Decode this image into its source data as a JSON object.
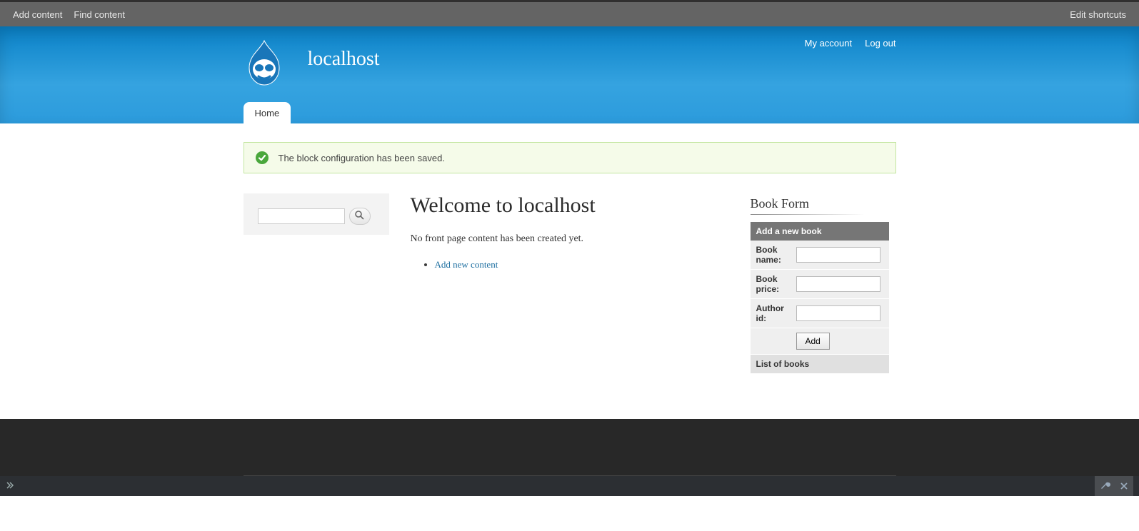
{
  "toolbar": {
    "add_content": "Add content",
    "find_content": "Find content",
    "edit_shortcuts": "Edit shortcuts"
  },
  "header": {
    "site_name": "localhost",
    "user_links": {
      "my_account": "My account",
      "log_out": "Log out"
    },
    "tabs": {
      "home": "Home"
    }
  },
  "status": {
    "message": "The block configuration has been saved."
  },
  "search": {
    "value": ""
  },
  "main": {
    "title": "Welcome to localhost",
    "no_content": "No front page content has been created yet.",
    "add_new": "Add new content"
  },
  "book_block": {
    "title": "Book Form",
    "header": "Add a new book",
    "fields": {
      "name_label": "Book name:",
      "price_label": "Book price:",
      "author_label": "Author id:"
    },
    "submit": "Add",
    "list_header": "List of books"
  }
}
